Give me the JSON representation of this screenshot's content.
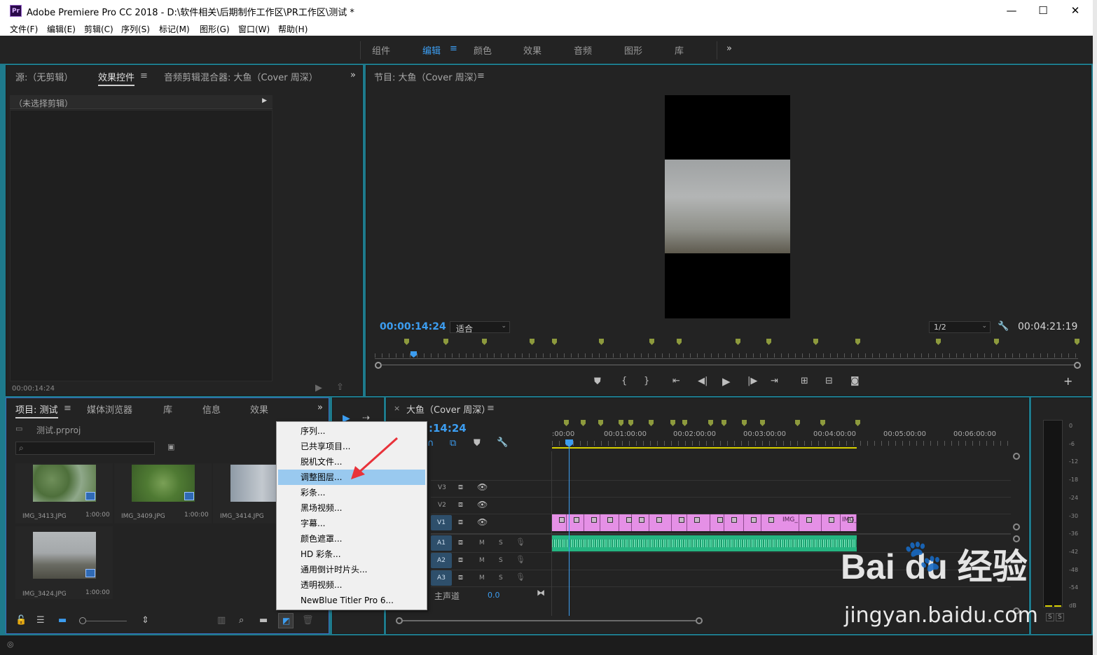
{
  "window": {
    "app_icon": "Pr",
    "title": "Adobe Premiere Pro CC 2018 - D:\\软件相关\\后期制作工作区\\PR工作区\\测试 *",
    "minimize": "—",
    "maximize": "☐",
    "close": "✕"
  },
  "menubar": [
    "文件(F)",
    "编辑(E)",
    "剪辑(C)",
    "序列(S)",
    "标记(M)",
    "图形(G)",
    "窗口(W)",
    "帮助(H)"
  ],
  "workspaces": {
    "items": [
      "组件",
      "编辑",
      "颜色",
      "效果",
      "音频",
      "图形",
      "库"
    ],
    "active_index": 1,
    "menu_glyph": "≡",
    "more_glyph": "»"
  },
  "source_panel": {
    "tabs": [
      "源:（无剪辑）",
      "效果控件",
      "音频剪辑混合器: 大鱼（Cover 周深）"
    ],
    "active_tab": 1,
    "menu_glyph": "≡",
    "more_glyph": "»",
    "no_clip_label": "（未选择剪辑）",
    "timecode": "00:00:14:24"
  },
  "program_monitor": {
    "title": "节目: 大鱼（Cover 周深）",
    "menu_glyph": "≡",
    "current_time": "00:00:14:24",
    "fit_label": "适合",
    "resolution": "1/2",
    "duration": "00:04:21:19",
    "add_button": "+"
  },
  "project_panel": {
    "tabs": [
      "项目: 测试",
      "媒体浏览器",
      "库",
      "信息",
      "效果",
      "»"
    ],
    "active_tab": 0,
    "menu_glyph": "≡",
    "project_file": "测试.prproj",
    "search_placeholder": "",
    "items": [
      {
        "name": "IMG_3413.JPG",
        "duration": "1:00:00"
      },
      {
        "name": "IMG_3409.JPG",
        "duration": "1:00:00"
      },
      {
        "name": "IMG_3414.JPG",
        "duration": ""
      },
      {
        "name": "IMG_3424.JPG",
        "duration": "1:00:00"
      }
    ]
  },
  "new_item_menu": {
    "items": [
      "序列...",
      "已共享项目...",
      "脱机文件...",
      "调整图层...",
      "彩条...",
      "黑场视频...",
      "字幕...",
      "颜色遮罩...",
      "HD 彩条...",
      "通用倒计时片头...",
      "透明视频...",
      "NewBlue Titler Pro 6..."
    ],
    "highlighted_index": 3
  },
  "timeline": {
    "close_glyph": "×",
    "sequence_name": "大鱼（Cover 周深）",
    "menu_glyph": "≡",
    "timecode": ":14:24",
    "ruler": [
      ":00:00",
      "00:01:00:00",
      "00:02:00:00",
      "00:03:00:00",
      "00:04:00:00",
      "00:05:00:00",
      "00:06:00:00"
    ],
    "video_tracks": [
      "V3",
      "V2",
      "V1"
    ],
    "audio_tracks": [
      "A1",
      "A2",
      "A3"
    ],
    "mute_label": "M",
    "solo_label": "S",
    "master_label": "主声道",
    "master_value": "0.0",
    "clip_labels": [
      "IMG_",
      "IMG_"
    ]
  },
  "audio_meter": {
    "scale": [
      "0",
      "-6",
      "-12",
      "-18",
      "-24",
      "-30",
      "-36",
      "-42",
      "-48",
      "-54",
      "dB"
    ],
    "solo_buttons": [
      "S",
      "S"
    ]
  },
  "watermark": {
    "brand": "Bai du 经验",
    "url": "jingyan.baidu.com"
  },
  "colors": {
    "accent_blue": "#3c9df0",
    "clip_video": "#e590e6",
    "clip_audio": "#25b581",
    "marker": "#8d9a3d",
    "menu_highlight": "#99c9ef"
  }
}
